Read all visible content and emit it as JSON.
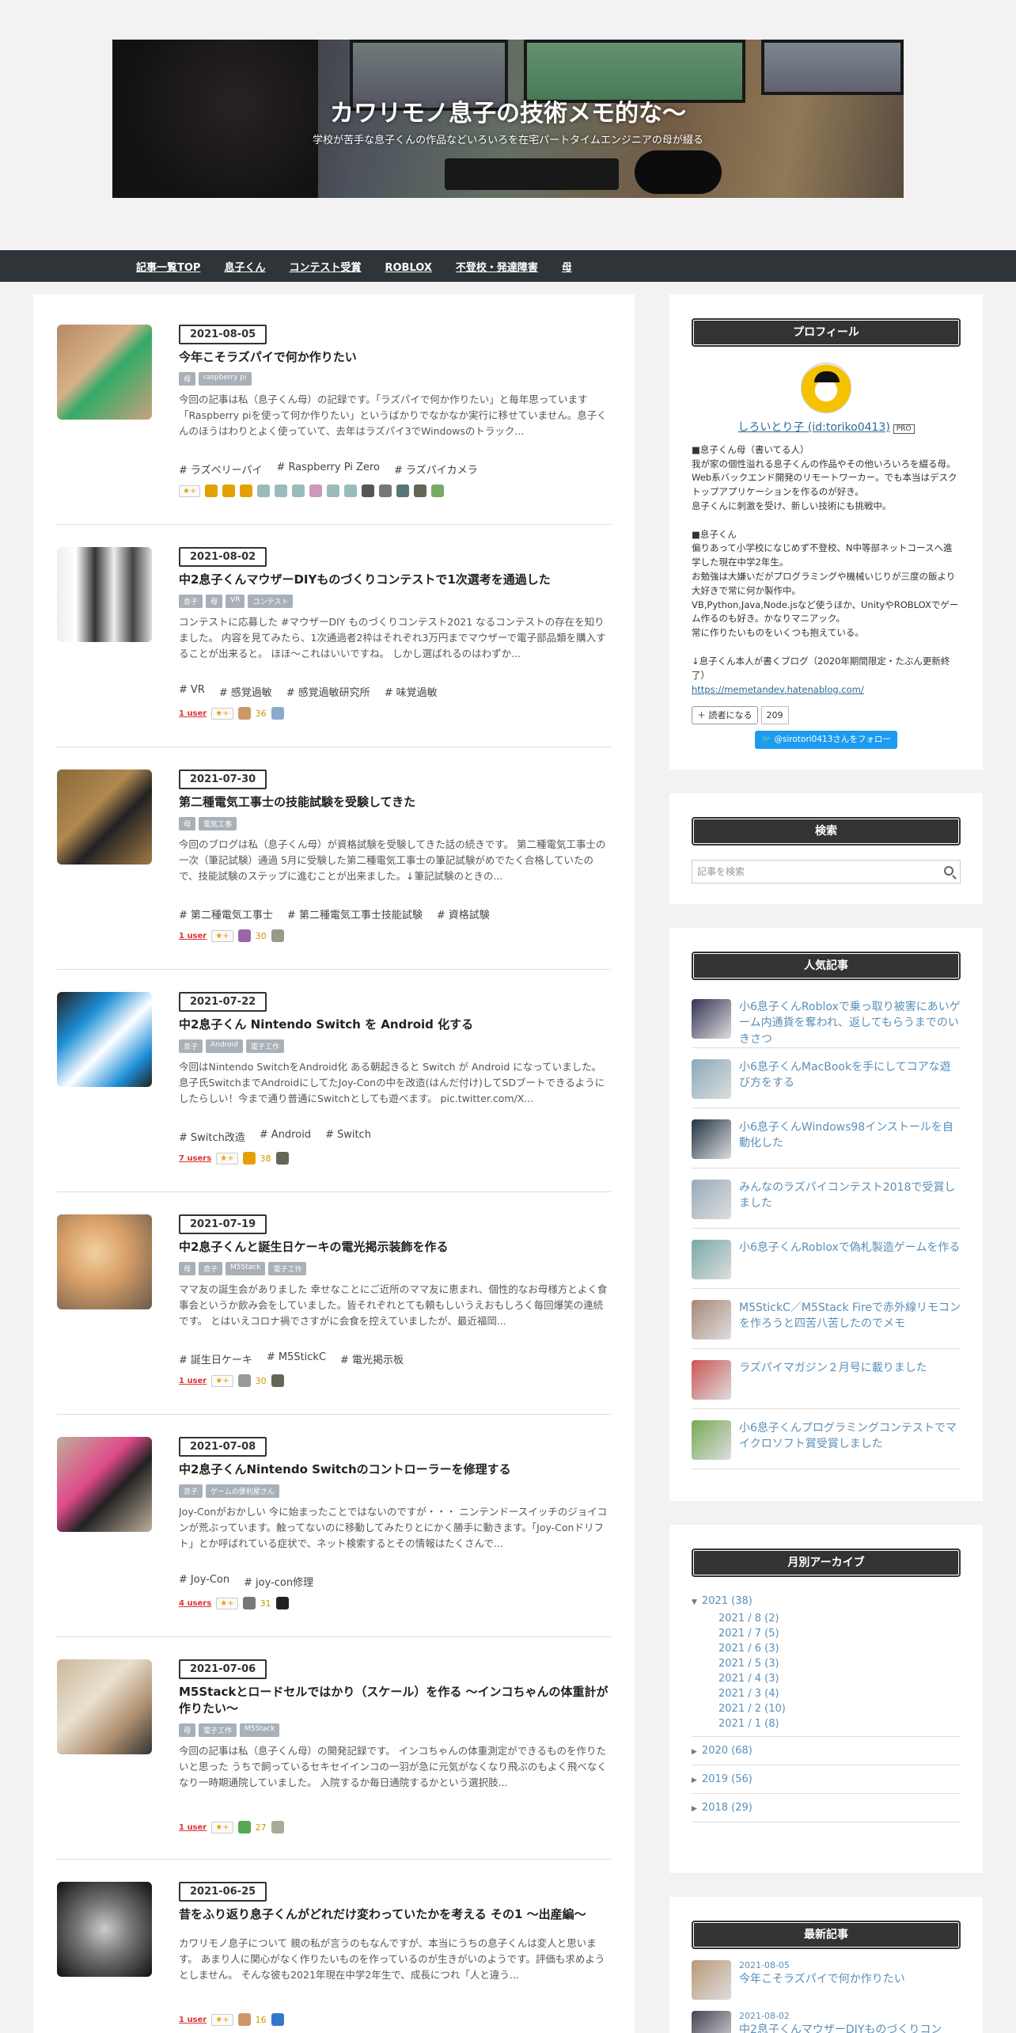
{
  "header": {
    "title": "カワリモノ息子の技術メモ的な〜",
    "description": "学校が苦手な息子くんの作品などいろいろを在宅パートタイムエンジニアの母が綴る"
  },
  "nav": [
    "記事一覧TOP",
    "息子くん",
    "コンテスト受賞",
    "ROBLOX",
    "不登校・発達障害",
    "母"
  ],
  "entries": [
    {
      "date": "2021-08-05",
      "title": "今年こそラズパイで何か作りたい",
      "categories": [
        "母",
        "raspberry pi"
      ],
      "excerpt": "今回の記事は私（息子くん母）の記録です。「ラズパイで何か作りたい」と毎年思っています「Raspberry piを使って何か作りたい」というばかりでなかなか実行に移せていません。息子くんのほうはわりとよく使っていて、去年はラズパイ3でWindowsのトラック...",
      "tags": [
        "ラズベリーパイ",
        "Raspberry Pi Zero",
        "ラズパイカメラ"
      ],
      "users": "",
      "star_count": "",
      "colors": [
        "#e4a000",
        "#e4a000",
        "#e4a000",
        "#9bb",
        "#9bb",
        "#9bb",
        "#c9b",
        "#9bb",
        "#9bb",
        "#555",
        "#777",
        "#577",
        "#665",
        "#7a6"
      ]
    },
    {
      "date": "2021-08-02",
      "title": "中2息子くんマウザーDIYものづくりコンテストで1次選考を通過した",
      "categories": [
        "息子",
        "母",
        "VR",
        "コンテスト"
      ],
      "excerpt": "コンテストに応募した #マウザーDIY ものづくりコンテスト2021 なるコンテストの存在を知りました。 内容を見てみたら、1次通過者2枠はそれぞれ3万円までマウザーで電子部品類を購入することが出来ると。 ほほ～これはいいですね。 しかし選ばれるのはわずか...",
      "tags": [
        "VR",
        "感覚過敏",
        "感覚過敏研究所",
        "味覚過敏"
      ],
      "users": "1 user",
      "star_count": "36",
      "colors": [
        "#c96",
        "#8ac"
      ]
    },
    {
      "date": "2021-07-30",
      "title": "第二種電気工事士の技能試験を受験してきた",
      "categories": [
        "母",
        "電気工事"
      ],
      "excerpt": "今回のブログは私（息子くん母）が資格試験を受験してきた話の続きです。 第二種電気工事士の一次（筆記試験）通過 5月に受験した第二種電気工事士の筆記試験がめでたく合格していたので、技能試験のステップに進むことが出来ました。↓筆記試験のときの...",
      "tags": [
        "第二種電気工事士",
        "第二種電気工事士技能試験",
        "資格試験"
      ],
      "users": "1 user",
      "star_count": "30",
      "colors": [
        "#96a",
        "#998"
      ]
    },
    {
      "date": "2021-07-22",
      "title": "中2息子くん Nintendo Switch を Android 化する",
      "categories": [
        "息子",
        "Android",
        "電子工作"
      ],
      "excerpt": "今回はNintendo SwitchをAndroid化 ある朝起きると Switch が Android になっていました。 息子氏SwitchまでAndroidにしてたJoy-Conの中を改造(はんだ付け)してSDブートできるようにしたらしい！今まで通り普通にSwitchとしても遊べます。 pic.twitter.com/X...",
      "tags": [
        "Switch改造",
        "Android",
        "Switch"
      ],
      "users": "7 users",
      "star_count": "38",
      "colors": [
        "#e4a000",
        "#665"
      ]
    },
    {
      "date": "2021-07-19",
      "title": "中2息子くんと誕生日ケーキの電光掲示装飾を作る",
      "categories": [
        "母",
        "息子",
        "M5Stack",
        "電子工作"
      ],
      "excerpt": "ママ友の誕生会がありました 幸せなことにご近所のママ友に恵まれ、個性的なお母様方とよく食事会というか飲み会をしていました。皆それぞれとても頼もしいうえおもしろく毎回爆笑の連続です。 とはいえコロナ禍でさすがに会食を控えていましたが、最近福岡...",
      "tags": [
        "誕生日ケーキ",
        "M5StickC",
        "電光掲示板"
      ],
      "users": "1 user",
      "star_count": "30",
      "colors": [
        "#999",
        "#665"
      ]
    },
    {
      "date": "2021-07-08",
      "title": "中2息子くんNintendo Switchのコントローラーを修理する",
      "categories": [
        "息子",
        "ゲームの便利屋さん"
      ],
      "excerpt": "Joy-Conがおかしい 今に始まったことではないのですが・・・ ニンテンドースイッチのジョイコンが荒ぶっています。触ってないのに移動してみたりとにかく勝手に動きます。「Joy-Conドリフト」とか呼ばれている症状で、ネット検索するとその情報はたくさんで...",
      "tags": [
        "Joy-Con",
        "joy-con修理"
      ],
      "users": "4 users",
      "star_count": "31",
      "colors": [
        "#777",
        "#222"
      ]
    },
    {
      "date": "2021-07-06",
      "title": "M5Stackとロードセルではかり（スケール）を作る ～インコちゃんの体重計が作りたい～",
      "categories": [
        "母",
        "電子工作",
        "M5Stack"
      ],
      "excerpt": "今回の記事は私（息子くん母）の開発記録です。 インコちゃんの体重測定ができるものを作りたいと思った うちで飼っているセキセイインコの一羽が急に元気がなくなり飛ぶのもよく飛べなくなり一時期通院していました。 入院するか毎日通院するかという選択肢...",
      "tags": [],
      "users": "1 user",
      "star_count": "27",
      "colors": [
        "#5a5",
        "#aa9"
      ]
    },
    {
      "date": "2021-06-25",
      "title": "昔をふり返り息子くんがどれだけ変わっていたかを考える その1 ～出産編～",
      "categories": [],
      "excerpt": "カワリモノ息子について 親の私が言うのもなんですが、本当にうちの息子くんは変人と思います。 あまり人に関心がなく作りたいものを作っているのが生きがいのようです。評価も求めようとしません。 そんな彼も2021年現在中学2年生で、成長につれ「人と違う...",
      "tags": [],
      "users": "1 user",
      "star_count": "16",
      "colors": [
        "#c96",
        "#37c"
      ]
    }
  ],
  "sidebar": {
    "profile": {
      "title": "プロフィール",
      "name": "しろいとり子 (id:toriko0413)",
      "pro": "PRO",
      "text": "■息子くん母（書いてる人）\n我が家の個性溢れる息子くんの作品やその他いろいろを綴る母。\nWeb系バックエンド開発のリモートワーカー。でも本当はデスクトップアプリケーションを作るのが好き。\n息子くんに刺激を受け、新しい技術にも挑戦中。\n\n■息子くん\n偏りあって小学校になじめず不登校、N中等部ネットコースへ進学した現在中学2年生。\nお勉強は大嫌いだがプログラミングや機械いじりが三度の飯より大好きで常に何か製作中。\nVB,Python,Java,Node.jsなど使うほか、UnityやROBLOXでゲーム作るのも好き。かなりマニアック。\n常に作りたいものをいくつも抱えている。\n\n↓息子くん本人が書くブログ（2020年期間限定・たぶん更新終了）",
      "link": "https://memetandev.hatenablog.com/",
      "reader_label": "読者になる",
      "reader_count": "209",
      "twitter": "@sirotori0413さんをフォロー"
    },
    "search": {
      "title": "検索",
      "placeholder": "記事を検索"
    },
    "popular": {
      "title": "人気記事",
      "items": [
        {
          "title": "小6息子くんRobloxで乗っ取り被害にあいゲーム内通貨を奪われ、返してもらうまでのいきさつ",
          "color": "#335"
        },
        {
          "title": "小6息子くんMacBookを手にしてコアな遊び方をする",
          "color": "#8ab"
        },
        {
          "title": "小6息子くんWindows98インストールを自動化した",
          "color": "#234"
        },
        {
          "title": "みんなのラズパイコンテスト2018で受賞しました",
          "color": "#9ab"
        },
        {
          "title": "小6息子くんRobloxで偽札製造ゲームを作る",
          "color": "#7aa"
        },
        {
          "title": "M5StickC／M5Stack Fireで赤外線リモコンを作ろうと四苦八苦したのでメモ",
          "color": "#a87"
        },
        {
          "title": "ラズパイマガジン２月号に載りました",
          "color": "#c55"
        },
        {
          "title": "小6息子くんプログラミングコンテストでマイクロソフト賞受賞しました",
          "color": "#7a5"
        }
      ]
    },
    "archive": {
      "title": "月別アーカイブ",
      "open_year": "2021 (38)",
      "months": [
        "2021 / 8 (2)",
        "2021 / 7 (5)",
        "2021 / 6 (3)",
        "2021 / 5 (3)",
        "2021 / 4 (3)",
        "2021 / 3 (4)",
        "2021 / 2 (10)",
        "2021 / 1 (8)"
      ],
      "years": [
        "2020 (68)",
        "2019 (56)",
        "2018 (29)"
      ]
    },
    "recent": {
      "title": "最新記事",
      "items": [
        {
          "date": "2021-08-05",
          "title": "今年こそラズパイで何か作りたい",
          "color": "#b97"
        },
        {
          "date": "2021-08-02",
          "title": "中2息子くんマウザーDIYものづくりコン",
          "color": "#445"
        }
      ]
    }
  }
}
